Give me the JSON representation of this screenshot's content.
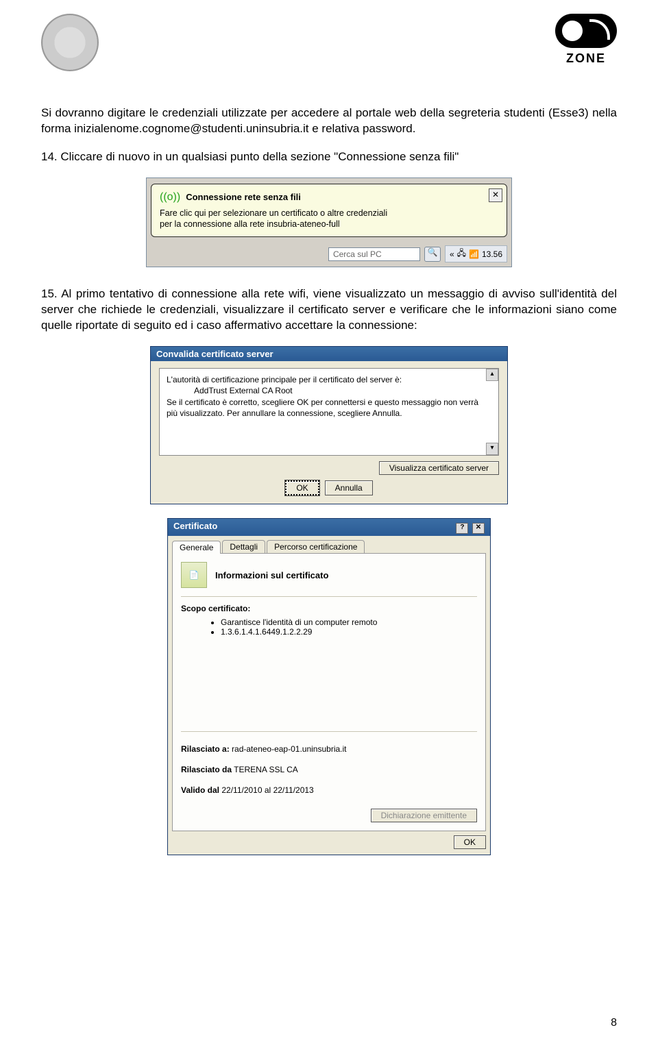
{
  "header": {
    "wifi_zone_label": "ZONE"
  },
  "para1": "Si dovranno digitare le credenziali utilizzate per accedere al portale web della segreteria studenti (Esse3) nella forma inizialenome.cognome@studenti.uninsubria.it e relativa password.",
  "para2": "14. Cliccare di nuovo in un qualsiasi punto della sezione \"Connessione senza fili\"",
  "balloon": {
    "title": "Connessione rete senza fili",
    "line1": "Fare clic qui per selezionare un certificato o altre credenziali",
    "line2": "per la connessione alla rete insubria-ateneo-full",
    "close": "✕"
  },
  "taskbar": {
    "search_placeholder": "Cerca sul PC",
    "chevrons": "«",
    "clock": "13.56"
  },
  "para3": "15. Al primo tentativo di connessione alla rete wifi, viene visualizzato un messaggio di avviso sull'identità del server che richiede le credenziali, visualizzare il certificato server e verificare che le informazioni siano come quelle riportate di seguito ed i caso affermativo accettare la connessione:",
  "validate": {
    "title": "Convalida certificato server",
    "l1": "L'autorità di certificazione principale per il certificato del server è:",
    "l2_indent": "AddTrust External CA Root",
    "l3": "Se il certificato è corretto, scegliere OK per connettersi e questo messaggio non verrà più visualizzato. Per annullare la connessione, scegliere Annulla.",
    "view_btn": "Visualizza certificato server",
    "ok": "OK",
    "cancel": "Annulla"
  },
  "cert": {
    "title": "Certificato",
    "help": "?",
    "close": "✕",
    "tabs": {
      "t1": "Generale",
      "t2": "Dettagli",
      "t3": "Percorso certificazione"
    },
    "info_title": "Informazioni sul certificato",
    "scope_title": "Scopo certificato:",
    "scope1": "Garantisce l'identità di un computer remoto",
    "scope2": "1.3.6.1.4.1.6449.1.2.2.29",
    "issued_to_label": "Rilasciato a:",
    "issued_to_value": "rad-ateneo-eap-01.uninsubria.it",
    "issued_by_label": "Rilasciato da",
    "issued_by_value": "TERENA SSL CA",
    "valid_label": "Valido dal",
    "valid_from": "22/11/2010",
    "valid_to_label": "al",
    "valid_to": "22/11/2013",
    "issuer_btn": "Dichiarazione emittente",
    "ok": "OK"
  },
  "page_number": "8"
}
